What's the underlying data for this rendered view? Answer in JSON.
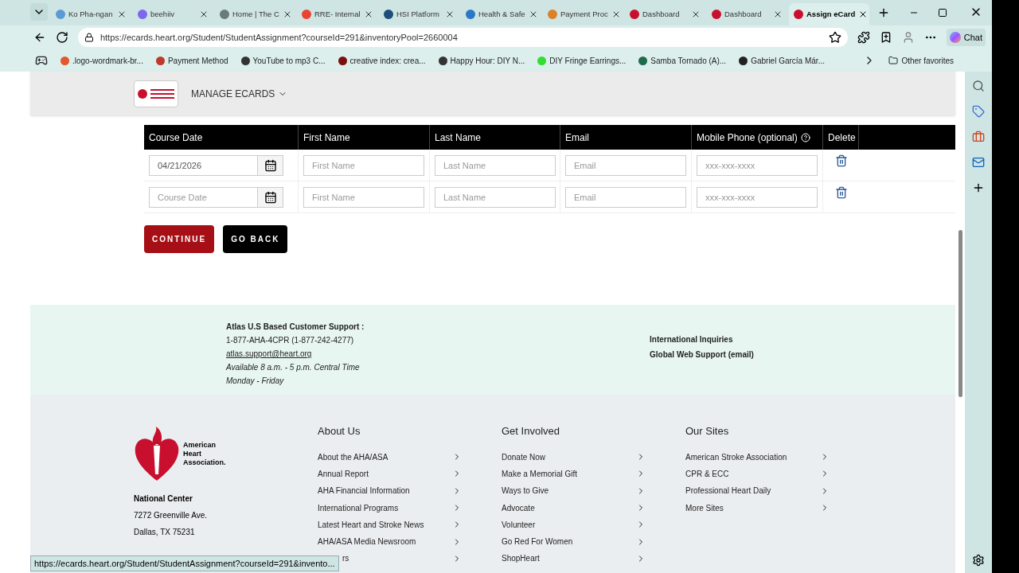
{
  "tabs": [
    {
      "title": "Ko Pha-ngan",
      "color": "#5b9bd5",
      "selected": false
    },
    {
      "title": "beehiiv",
      "color": "#7b68ee",
      "selected": false
    },
    {
      "title": "Home | The C",
      "color": "#6b7b7b",
      "selected": false
    },
    {
      "title": "RRE- Internal",
      "color": "#ea4335",
      "selected": false
    },
    {
      "title": "HSI Platform",
      "color": "#1f4e79",
      "selected": false
    },
    {
      "title": "Health & Safe",
      "color": "#2b78c5",
      "selected": false
    },
    {
      "title": "Payment Proc",
      "color": "#d9822b",
      "selected": false
    },
    {
      "title": "Dashboard",
      "color": "#c8102e",
      "selected": false
    },
    {
      "title": "Dashboard",
      "color": "#c8102e",
      "selected": false
    },
    {
      "title": "Assign eCard",
      "color": "#c8102e",
      "selected": true
    }
  ],
  "address": "https://ecards.heart.org/Student/StudentAssignment?courseId=291&inventoryPool=2660004",
  "chat_label": "Chat",
  "bookmarks": [
    {
      "title": ".logo-wordmark-br...",
      "color": "#e2582b"
    },
    {
      "title": "Payment Method",
      "color": "#c0392b"
    },
    {
      "title": "YouTube to mp3 C...",
      "color": "#333333"
    },
    {
      "title": "creative index: crea...",
      "color": "#7a1010"
    },
    {
      "title": "Happy Hour: DIY N...",
      "color": "#333333"
    },
    {
      "title": "DIY Fringe Earrings...",
      "color": "#33dd33"
    },
    {
      "title": "Samba Tornado (A)...",
      "color": "#1e6b4a"
    },
    {
      "title": "Gabriel García Már...",
      "color": "#222222"
    }
  ],
  "other_favorites": "Other favorites",
  "menu": {
    "label": "MANAGE ECARDS"
  },
  "table": {
    "columns": [
      "Course Date",
      "First Name",
      "Last Name",
      "Email",
      "Mobile Phone (optional)",
      "Delete"
    ],
    "rows": [
      {
        "course_date": {
          "value": "04/21/2026"
        },
        "first_name": {
          "placeholder": "First Name"
        },
        "last_name": {
          "placeholder": "Last Name"
        },
        "email": {
          "placeholder": "Email"
        },
        "phone": {
          "placeholder": "xxx-xxx-xxxx"
        }
      },
      {
        "course_date": {
          "placeholder": "Course Date"
        },
        "first_name": {
          "placeholder": "First Name"
        },
        "last_name": {
          "placeholder": "Last Name"
        },
        "email": {
          "placeholder": "Email"
        },
        "phone": {
          "placeholder": "xxx-xxx-xxxx"
        }
      }
    ]
  },
  "buttons": [
    {
      "label": "CONTINUE",
      "kind": "primary"
    },
    {
      "label": "GO BACK",
      "kind": "secondary"
    }
  ],
  "support": {
    "title": "Atlas U.S Based Customer Support :",
    "phone": "1-877-AHA-4CPR (1-877-242-4277)",
    "email": "atlas.support@heart.org",
    "hours": "Available 8 a.m. - 5 p.m. Central Time",
    "days": "Monday - Friday",
    "links": [
      "International Inquiries",
      "Global Web Support (email)"
    ]
  },
  "footer": {
    "logo_text": [
      "American",
      "Heart",
      "Association."
    ],
    "center_title": "National Center",
    "address": [
      "7272 Greenville Ave.",
      "Dallas, TX 75231"
    ],
    "columns": [
      {
        "title": "About Us",
        "links": [
          "About the AHA/ASA",
          "Annual Report",
          "AHA Financial Information",
          "International Programs",
          "Latest Heart and Stroke News",
          "AHA/ASA Media Newsroom",
          "rs"
        ]
      },
      {
        "title": "Get Involved",
        "links": [
          "Donate Now",
          "Make a Memorial Gift",
          "Ways to Give",
          "Advocate",
          "Volunteer",
          "Go Red For Women",
          "ShopHeart"
        ]
      },
      {
        "title": "Our Sites",
        "links": [
          "American Stroke Association",
          "CPR & ECC",
          "Professional Heart Daily",
          "More Sites"
        ]
      }
    ]
  },
  "status_url": "https://ecards.heart.org/Student/StudentAssignment?courseId=291&invento..."
}
